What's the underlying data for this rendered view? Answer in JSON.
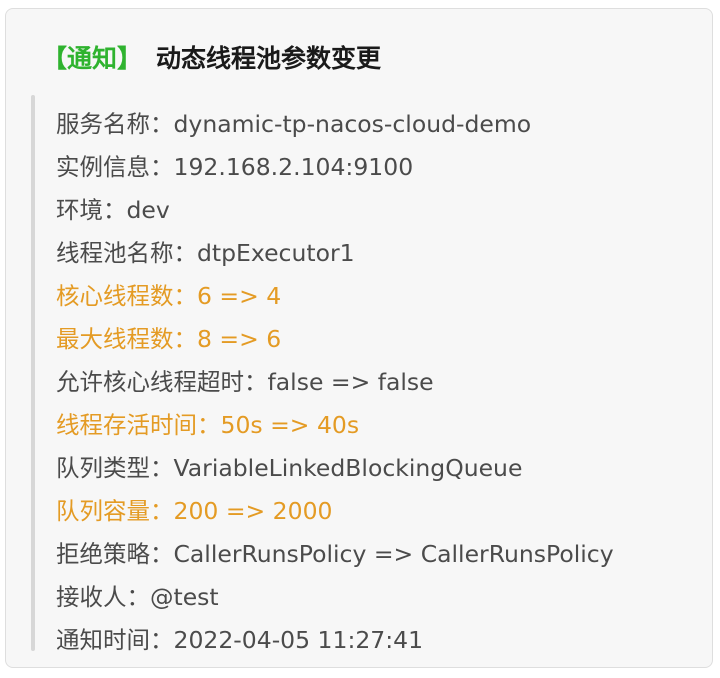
{
  "header": {
    "tag": "【通知】",
    "title": "动态线程池参数变更"
  },
  "colors": {
    "tag": "#2fb32f",
    "highlight": "#e49b24",
    "text": "#4b4b4b",
    "card_background": "#f7f7f7"
  },
  "lines": [
    {
      "text": "服务名称：dynamic-tp-nacos-cloud-demo",
      "highlight": false
    },
    {
      "text": "实例信息：192.168.2.104:9100",
      "highlight": false
    },
    {
      "text": "环境：dev",
      "highlight": false
    },
    {
      "text": "线程池名称：dtpExecutor1",
      "highlight": false
    },
    {
      "text": "核心线程数：6 => 4",
      "highlight": true
    },
    {
      "text": "最大线程数：8 => 6",
      "highlight": true
    },
    {
      "text": "允许核心线程超时：false => false",
      "highlight": false
    },
    {
      "text": "线程存活时间：50s => 40s",
      "highlight": true
    },
    {
      "text": "队列类型：VariableLinkedBlockingQueue",
      "highlight": false
    },
    {
      "text": "队列容量：200 => 2000",
      "highlight": true
    },
    {
      "text": "拒绝策略：CallerRunsPolicy => CallerRunsPolicy",
      "highlight": false
    },
    {
      "text": "接收人：@test",
      "highlight": false
    },
    {
      "text": "通知时间：2022-04-05 11:27:41",
      "highlight": false
    }
  ]
}
